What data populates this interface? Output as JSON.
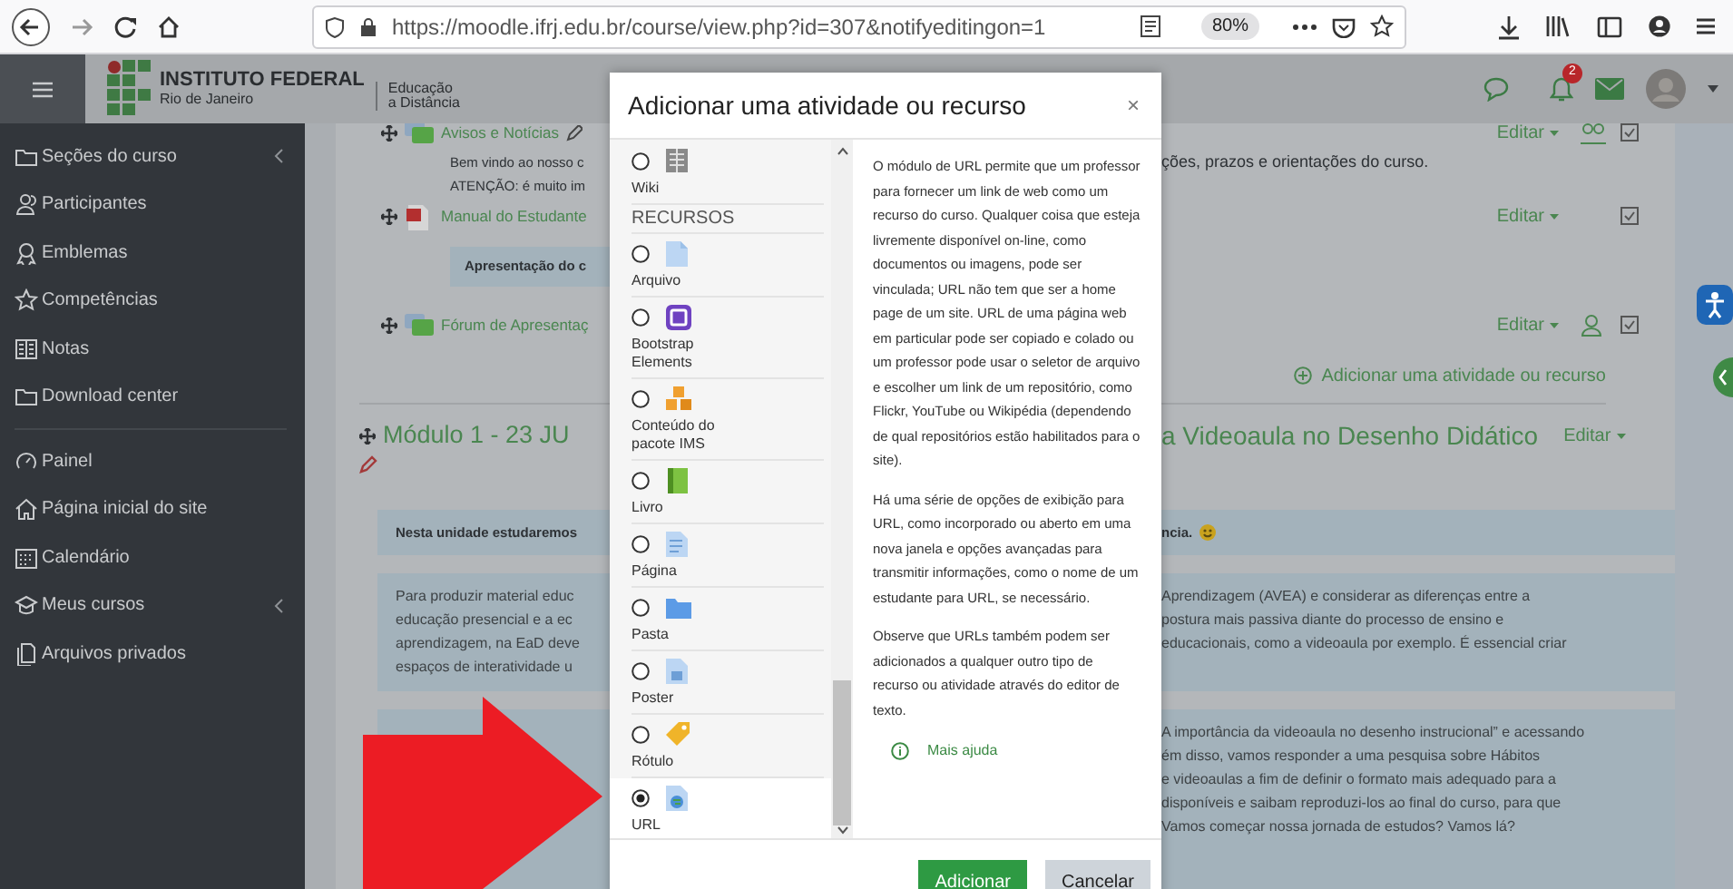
{
  "browser": {
    "url": "https://moodle.ifrj.edu.br/course/view.php?id=307&notifyeditingon=1",
    "zoom": "80%"
  },
  "header": {
    "logo_title": "INSTITUTO FEDERAL",
    "logo_subtitle": "Rio de Janeiro",
    "unit_line_1": "Educação",
    "unit_line_2": "a Distância",
    "notification_count": "2"
  },
  "sidebar": {
    "groups": [
      [
        {
          "label": "Seções do curso",
          "expandable": true
        },
        {
          "label": "Participantes",
          "expandable": false
        },
        {
          "label": "Emblemas",
          "expandable": false
        },
        {
          "label": "Competências",
          "expandable": false
        },
        {
          "label": "Notas",
          "expandable": false
        },
        {
          "label": "Download center",
          "expandable": false
        }
      ],
      [
        {
          "label": "Painel",
          "expandable": false
        },
        {
          "label": "Página inicial do site",
          "expandable": false
        },
        {
          "label": "Calendário",
          "expandable": false
        },
        {
          "label": "Meus cursos",
          "expandable": true
        },
        {
          "label": "Arquivos privados",
          "expandable": false
        }
      ]
    ]
  },
  "course": {
    "activities": [
      {
        "title": "Avisos e Notícias",
        "edit_label": "Editar",
        "description_left": [
          "Bem vindo ao nosso c",
          "ATENÇÃO: é muito im"
        ],
        "description_right": [
          "ções, prazos e orientações do curso."
        ]
      },
      {
        "title": "Manual do Estudante",
        "edit_label": "Editar",
        "note": "Apresentação do c"
      },
      {
        "title": "Fórum de Apresentaç",
        "edit_label": "Editar"
      }
    ],
    "add_activity": "Adicionar uma atividade ou recurso",
    "module": {
      "title_left": "Módulo 1 - 23 JU",
      "title_right": "a Videoaula no Desenho Didático",
      "edit_label": "Editar"
    },
    "boxes": [
      {
        "kind": "summary",
        "left": [
          "Nesta unidade estudaremos"
        ],
        "right": [
          "ncia."
        ]
      },
      {
        "kind": "text",
        "left": [
          "Para produzir material educ",
          "educação presencial e a ec",
          "aprendizagem, na EaD deve",
          "espaços de interatividade u"
        ],
        "right": [
          "Aprendizagem (AVEA) e considerar as diferenças entre a",
          "postura mais passiva diante do processo de ensino e",
          "educacionais, como a videoaula por exemplo. É essencial criar"
        ]
      },
      {
        "kind": "text",
        "right": [
          "A importância da videoaula no desenho instrucional” e acessando",
          "ém disso, vamos responder a uma pesquisa sobre Hábitos",
          "e videoaulas a fim de definir o formato mais adequado para a",
          "disponíveis e saibam reproduzi-los ao final do curso, para que",
          "Vamos começar nossa jornada de estudos? Vamos lá?"
        ]
      }
    ]
  },
  "modal": {
    "title": "Adicionar uma atividade ou recurso",
    "close": "×",
    "items": [
      {
        "kind": "option",
        "label": "Wiki",
        "selected": false
      },
      {
        "kind": "header",
        "label": "RECURSOS"
      },
      {
        "kind": "option",
        "label": "Arquivo",
        "selected": false
      },
      {
        "kind": "option",
        "label": "Bootstrap Elements",
        "selected": false
      },
      {
        "kind": "option",
        "label": "Conteúdo do pacote IMS",
        "selected": false
      },
      {
        "kind": "option",
        "label": "Livro",
        "selected": false
      },
      {
        "kind": "option",
        "label": "Página",
        "selected": false
      },
      {
        "kind": "option",
        "label": "Pasta",
        "selected": false
      },
      {
        "kind": "option",
        "label": "Poster",
        "selected": false
      },
      {
        "kind": "option",
        "label": "Rótulo",
        "selected": false
      },
      {
        "kind": "option",
        "label": "URL",
        "selected": true
      }
    ],
    "description": [
      "O módulo de URL permite que um professor para fornecer um link de web como um recurso do curso. Qualquer coisa que esteja livremente disponível on-line, como documentos ou imagens, pode ser vinculada; URL não tem que ser a home page de um site. URL de uma página web em particular pode ser copiado e colado ou um professor pode usar o seletor de arquivo e escolher um link de um repositório, como Flickr, YouTube ou Wikipédia (dependendo de qual repositórios estão habilitados para o site).",
      "Há uma série de opções de exibição para URL, como incorporado ou aberto em uma nova janela e opções avançadas para transmitir informações, como o nome de um estudante para URL, se necessário.",
      "Observe que URLs também podem ser adicionados a qualquer outro tipo de recurso ou atividade através do editor de texto."
    ],
    "help_link": "Mais ajuda",
    "buttons": [
      {
        "label": "Adicionar",
        "kind": "primary"
      },
      {
        "label": "Cancelar",
        "kind": "secondary"
      }
    ]
  }
}
